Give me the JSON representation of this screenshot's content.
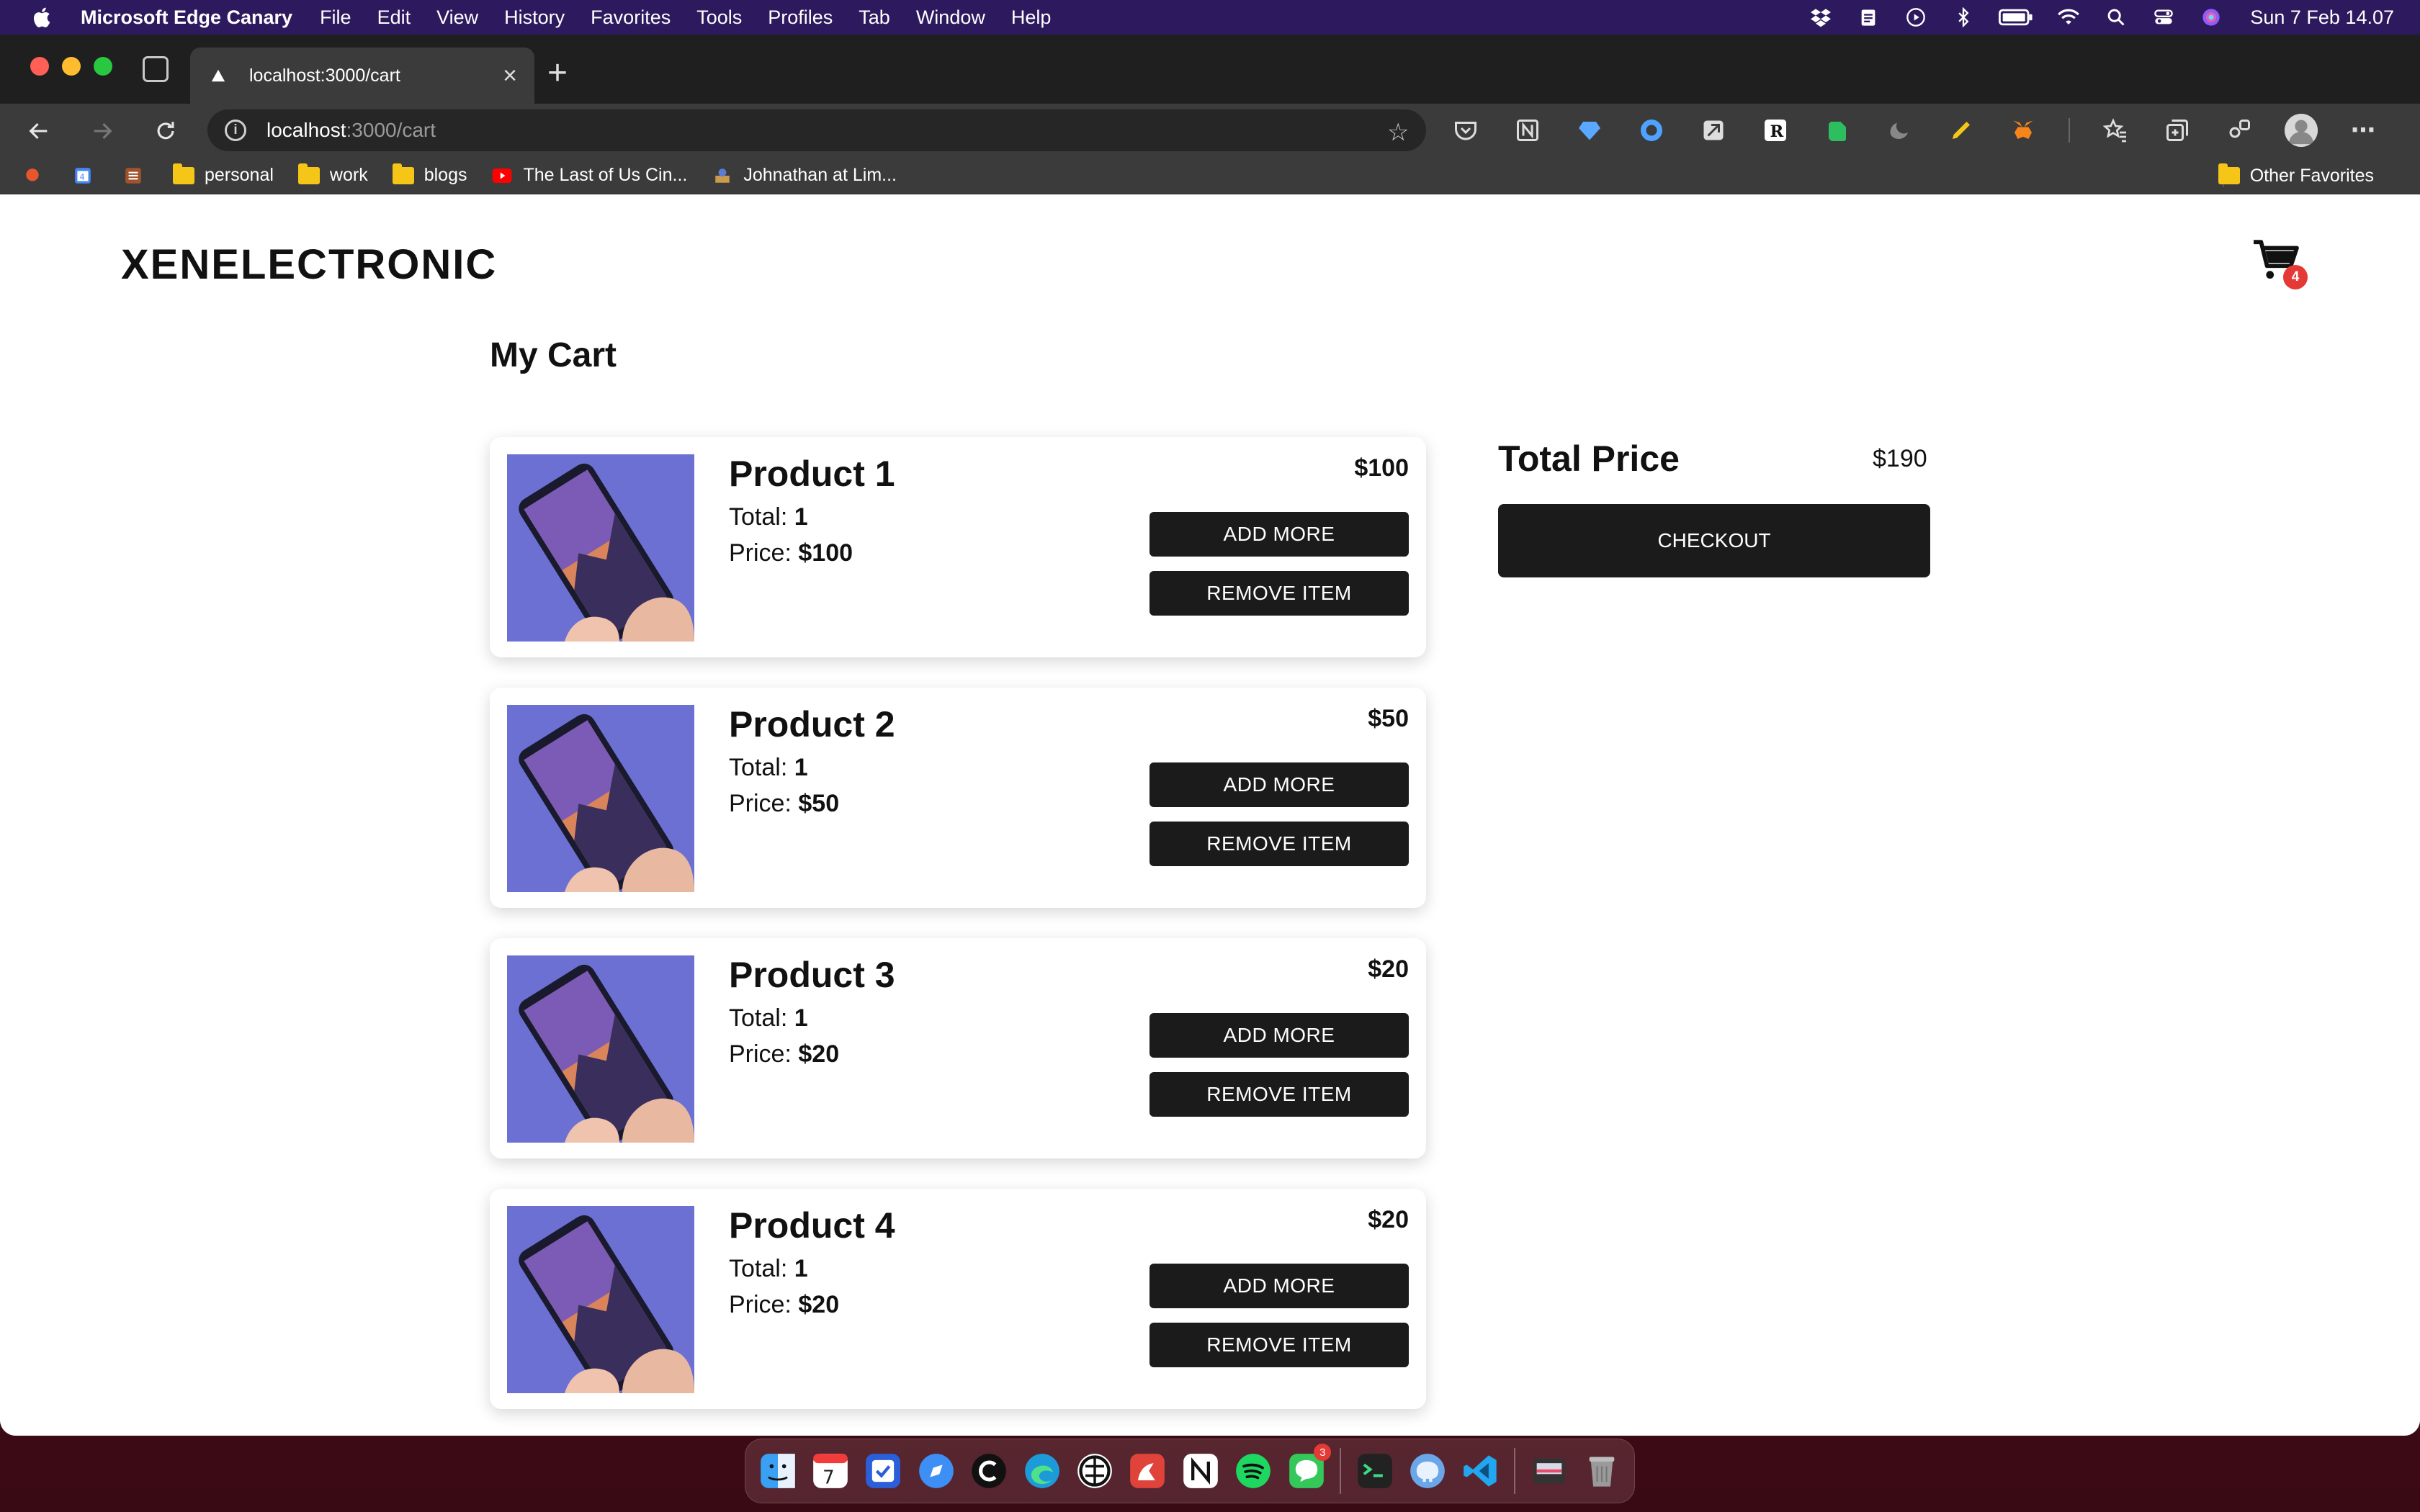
{
  "menubar": {
    "app_name": "Microsoft Edge Canary",
    "items": [
      "File",
      "Edit",
      "View",
      "History",
      "Favorites",
      "Tools",
      "Profiles",
      "Tab",
      "Window",
      "Help"
    ],
    "clock": "Sun 7 Feb  14.07"
  },
  "browser": {
    "tab_title": "localhost:3000/cart",
    "url_host": "localhost",
    "url_path": ":3000/cart",
    "bookmarks": [
      {
        "label": "personal",
        "icon": "folder-icon"
      },
      {
        "label": "work",
        "icon": "folder-icon"
      },
      {
        "label": "blogs",
        "icon": "folder-icon"
      },
      {
        "label": "The Last of Us Cin...",
        "icon": "youtube-icon"
      },
      {
        "label": "Johnathan at Lim...",
        "icon": "web-icon"
      }
    ],
    "other_favorites": "Other Favorites"
  },
  "site": {
    "logo": "XENELECTRONIC",
    "cart_count": "4"
  },
  "cart": {
    "title": "My Cart",
    "total_label": "Total:",
    "price_label": "Price:",
    "add_label": "ADD MORE",
    "remove_label": "REMOVE ITEM",
    "items": [
      {
        "name": "Product 1",
        "total": "1",
        "price": "$100",
        "subtotal": "$100"
      },
      {
        "name": "Product 2",
        "total": "1",
        "price": "$50",
        "subtotal": "$50"
      },
      {
        "name": "Product 3",
        "total": "1",
        "price": "$20",
        "subtotal": "$20"
      },
      {
        "name": "Product 4",
        "total": "1",
        "price": "$20",
        "subtotal": "$20"
      }
    ]
  },
  "summary": {
    "title": "Total Price",
    "value": "$190",
    "checkout_label": "CHECKOUT"
  },
  "colors": {
    "button_bg": "#1b1b1b",
    "badge": "#e53935",
    "product_bg": "#6b6fd0"
  }
}
